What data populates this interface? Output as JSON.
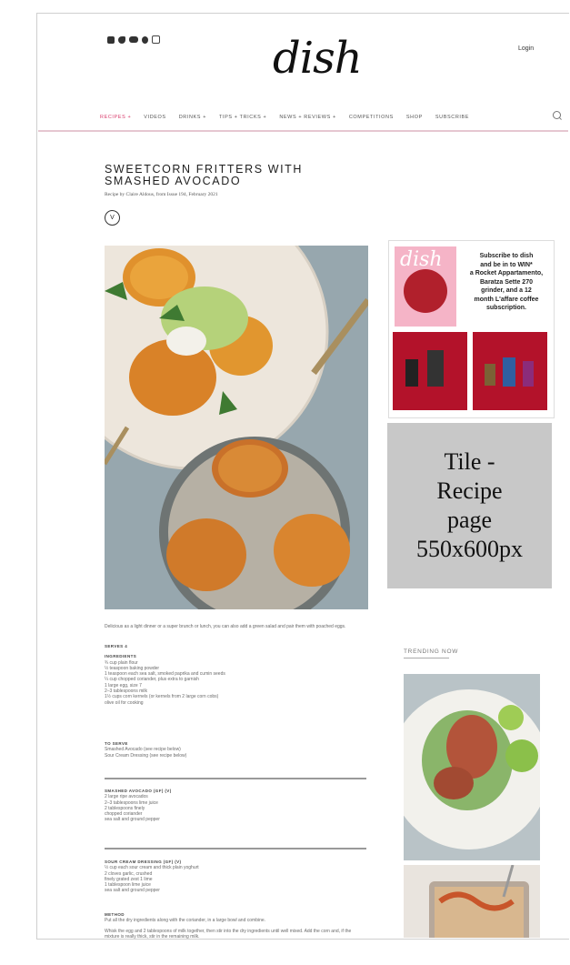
{
  "site": {
    "logo": "dish",
    "login": "Login"
  },
  "social_icons": [
    "facebook-icon",
    "twitter-icon",
    "youtube-icon",
    "pinterest-icon",
    "instagram-icon"
  ],
  "nav": {
    "items": [
      "RECIPES +",
      "VIDEOS",
      "DRINKS +",
      "TIPS + TRICKS +",
      "NEWS + REVIEWS +",
      "COMPETITIONS",
      "SHOP",
      "SUBSCRIBE"
    ],
    "active_color": "#d93b6b"
  },
  "recipe": {
    "title": "SWEETCORN FRITTERS WITH SMASHED AVOCADO",
    "byline": "Recipe by Claire Aldous, from Issue 194, February 2021",
    "badge": "V",
    "intro": "Delicious as a light dinner or a super brunch or lunch, you can also add a green salad and pair them with poached eggs.",
    "serves": "SERVES 4",
    "ingredients_heading": "INGREDIENTS",
    "ingredients": [
      "¾ cup plain flour",
      "½ teaspoon baking powder",
      "1 teaspoon each sea salt, smoked paprika and cumin seeds",
      "¼ cup chopped coriander, plus extra to garnish",
      "1 large egg, size 7",
      "2–3 tablespoons milk",
      "1½ cups corn kernels (or kernels from 2 large corn cobs)",
      "olive oil for cooking"
    ],
    "to_serve_heading": "TO SERVE",
    "to_serve": [
      "Smashed Avocado (see recipe below)",
      "Sour Cream Dressing (see recipe below)"
    ],
    "avocado_heading": "SMASHED AVOCADO (GF) (V)",
    "avocado": [
      "2 large ripe avocados",
      "2–3 tablespoons lime juice",
      "2 tablespoons finely",
      "chopped coriander",
      "sea salt and ground pepper"
    ],
    "dressing_heading": "SOUR CREAM DRESSING (GF) (V)",
    "dressing": [
      "½ cup each sour cream and thick plain yoghurt",
      "2 cloves garlic, crushed",
      "finely grated zest 1 lime",
      "1 tablespoon lime juice",
      "sea salt and ground pepper"
    ],
    "method_heading": "METHOD",
    "method": [
      "Put all the dry ingredients along with the coriander, in a large bowl and combine.",
      "Whisk the egg and 2 tablespoons of milk together, then stir into the dry ingredients until well mixed. Add the corn and, if the mixture is really thick, stir in the remaining milk."
    ]
  },
  "ad": {
    "text": [
      "Subscribe to dish",
      "and be in to WIN*",
      "a Rocket Appartamento,",
      "Baratza Sette 270",
      "grinder, and a 12",
      "month L'affare coffee",
      "subscription."
    ],
    "cover_logo": "dish"
  },
  "tile": {
    "lines": [
      "Tile -",
      "Recipe",
      "page",
      "550x600px"
    ]
  },
  "sidebar": {
    "trending_heading": "TRENDING NOW"
  }
}
